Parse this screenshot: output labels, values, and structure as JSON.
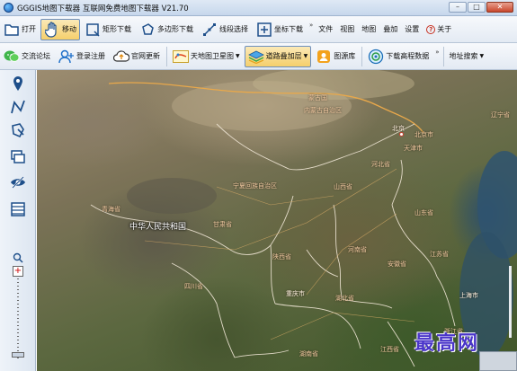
{
  "window": {
    "title": "GGGIS地图下载器 互联网免费地图下载器 V21.70",
    "minimize": "–",
    "maximize": "□",
    "close": "✕"
  },
  "toolbar1": {
    "open": "打开",
    "move": "移动",
    "rect_download": "矩形下载",
    "polygon_download": "多边形下载",
    "line_select": "线段选择",
    "coord_download": "坐标下载",
    "overflow": "»",
    "menus": [
      "文件",
      "视图",
      "地图",
      "叠加",
      "设置"
    ],
    "about": "关于"
  },
  "toolbar2": {
    "forum": "交流论坛",
    "register": "登录注册",
    "update": "官网更新",
    "tianditu": "天地图卫星图",
    "road_overlay": "道路叠加层",
    "library": "图源库",
    "elevation": "下载高程数据",
    "overflow": "»",
    "address_search": "地址搜索"
  },
  "map": {
    "country_label": "中华人民共和国",
    "labels": [
      "蒙古国",
      "内蒙古自治区",
      "北京",
      "北京市",
      "天津市",
      "辽宁省",
      "河北省",
      "青海省",
      "宁夏回族自治区",
      "山西省",
      "山东省",
      "甘肃省",
      "河南省",
      "陕西省",
      "安徽省",
      "江苏省",
      "四川省",
      "重庆市",
      "湖北省",
      "上海市",
      "湖南省",
      "江西省",
      "浙江省"
    ],
    "watermark": "最高网"
  },
  "colors": {
    "accent": "#f5cf6b",
    "boundary": "#f2e8d8",
    "road": "#e3b26a"
  },
  "icons": {
    "open": "folder-icon",
    "move": "hand-icon",
    "rect": "rectangle-icon",
    "polygon": "polygon-icon",
    "line": "line-select-icon",
    "coord": "crosshair-icon",
    "forum": "chat-icon",
    "register": "user-icon",
    "update": "cloud-upload-icon",
    "tianditu": "tianditu-logo-icon",
    "overlay": "layers-icon",
    "library": "library-icon",
    "elevation": "globe-icon",
    "side": [
      "marker-icon",
      "polyline-icon",
      "polygon-select-icon",
      "layers-stack-icon",
      "hide-eye-icon",
      "list-icon",
      "zoom-icon"
    ]
  }
}
